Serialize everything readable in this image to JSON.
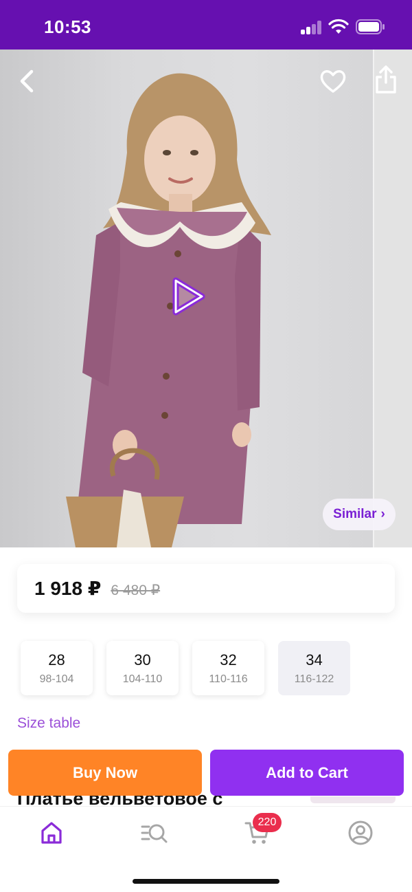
{
  "status_bar": {
    "time": "10:53"
  },
  "colors": {
    "brand_purple": "#6610b0",
    "accent_purple": "#9030f0",
    "link_purple": "#9b4fd8",
    "buy_orange": "#ff8426",
    "badge_red": "#ea2e4d"
  },
  "header_icons": [
    "back-icon",
    "heart-icon",
    "share-icon"
  ],
  "hero": {
    "similar_label": "Similar",
    "similar_arrow": "›"
  },
  "price": {
    "current": "1 918 ₽",
    "old": "6 480 ₽"
  },
  "sizes": [
    {
      "size": "28",
      "range": "98-104",
      "available": true
    },
    {
      "size": "30",
      "range": "104-110",
      "available": true
    },
    {
      "size": "32",
      "range": "110-116",
      "available": true
    },
    {
      "size": "34",
      "range": "116-122",
      "available": false
    }
  ],
  "size_table_label": "Size table",
  "actions": {
    "buy_now": "Buy Now",
    "add_to_cart": "Add to Cart"
  },
  "product_title_peek": "Платье вельветовое с",
  "tab_bar": {
    "tabs": [
      "home-icon",
      "catalog-search-icon",
      "cart-icon",
      "profile-icon"
    ],
    "active": "home",
    "cart_badge": "220"
  }
}
